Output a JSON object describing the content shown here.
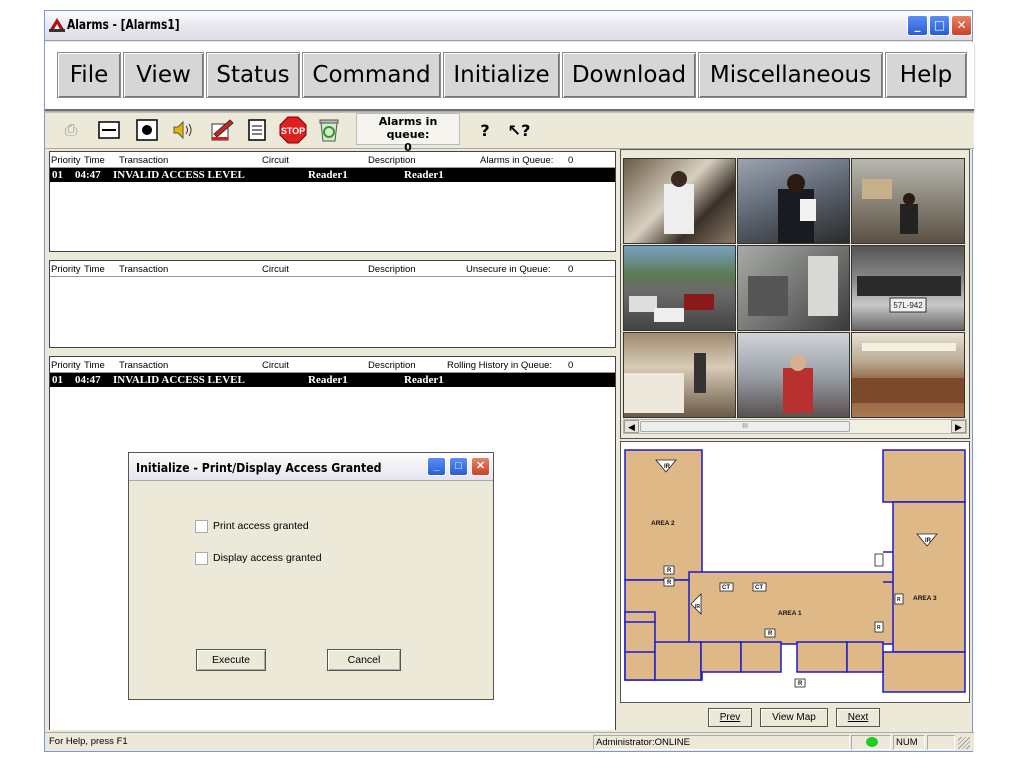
{
  "window": {
    "title": "Alarms - [Alarms1]",
    "controls": {
      "minimize": "_",
      "maximize": "□",
      "close": "✕"
    }
  },
  "menu": [
    "File",
    "View",
    "Status",
    "Command",
    "Initialize",
    "Download",
    "Miscellaneous",
    "Help"
  ],
  "toolbar": {
    "icons": [
      "printer-icon",
      "window-icon",
      "record-icon",
      "speaker-icon",
      "edit-icon",
      "notes-icon",
      "stop-icon",
      "recycle-icon",
      "help-icon",
      "context-help-icon"
    ],
    "stop_label": "STOP",
    "queue_label": "Alarms in queue:",
    "queue_count": "0"
  },
  "alarms_pane": {
    "columns": [
      "Priority",
      "Time",
      "Transaction",
      "Circuit",
      "Description"
    ],
    "queue_label": "Alarms in Queue:",
    "queue_count": "0",
    "rows": [
      {
        "priority": "01",
        "time": "04:47",
        "transaction": "INVALID ACCESS LEVEL",
        "circuit": "Reader1",
        "description": "Reader1"
      }
    ]
  },
  "unsecure_pane": {
    "columns": [
      "Priority",
      "Time",
      "Transaction",
      "Circuit",
      "Description"
    ],
    "queue_label": "Unsecure in Queue:",
    "queue_count": "0"
  },
  "history_pane": {
    "columns": [
      "Priority",
      "Time",
      "Transaction",
      "Circuit",
      "Description"
    ],
    "queue_label": "Rolling History in Queue:",
    "queue_count": "0",
    "rows": [
      {
        "priority": "01",
        "time": "04:47",
        "transaction": "INVALID ACCESS LEVEL",
        "circuit": "Reader1",
        "description": "Reader1"
      }
    ]
  },
  "video": {
    "plate_text": "57L-942",
    "scroll_thumb": "III"
  },
  "map": {
    "areas": [
      "AREA 2",
      "AREA 1",
      "AREA 3"
    ],
    "device_labels": {
      "ir": "IR",
      "reader": "R",
      "ct": "CT"
    },
    "nav": {
      "prev": "Prev",
      "view_map": "View Map",
      "next": "Next"
    },
    "colors": {
      "floor": "#deb887",
      "walls": "#1a1acc"
    }
  },
  "dialog": {
    "title": "Initialize - Print/Display Access Granted",
    "options": [
      {
        "label": "Print access granted",
        "checked": false
      },
      {
        "label": "Display access granted",
        "checked": false
      }
    ],
    "execute_label": "Execute",
    "cancel_label": "Cancel"
  },
  "status": {
    "help_text": "For Help, press F1",
    "user_status": "Administrator:ONLINE",
    "num_lock": "NUM",
    "online_color": "#22cc22"
  }
}
